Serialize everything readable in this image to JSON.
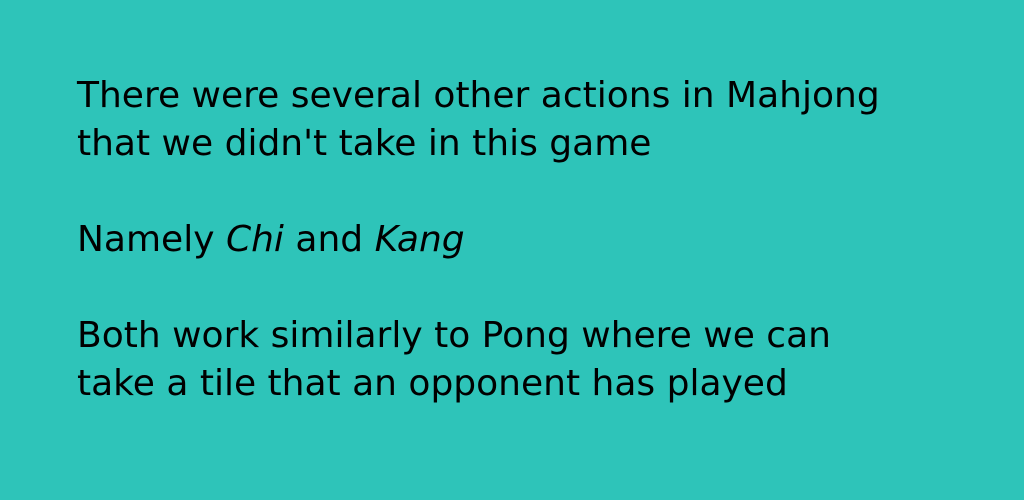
{
  "background_color": "#2ec4b9",
  "paragraphs": {
    "p1_line1": "There were several other actions in Mahjong",
    "p1_line2": "that we didn't take in this game",
    "p2_prefix": "Namely ",
    "p2_term1": "Chi",
    "p2_middle": " and ",
    "p2_term2": "Kang",
    "p3_line1": "Both work similarly to Pong where we can",
    "p3_line2": "take a tile that an opponent has played"
  }
}
